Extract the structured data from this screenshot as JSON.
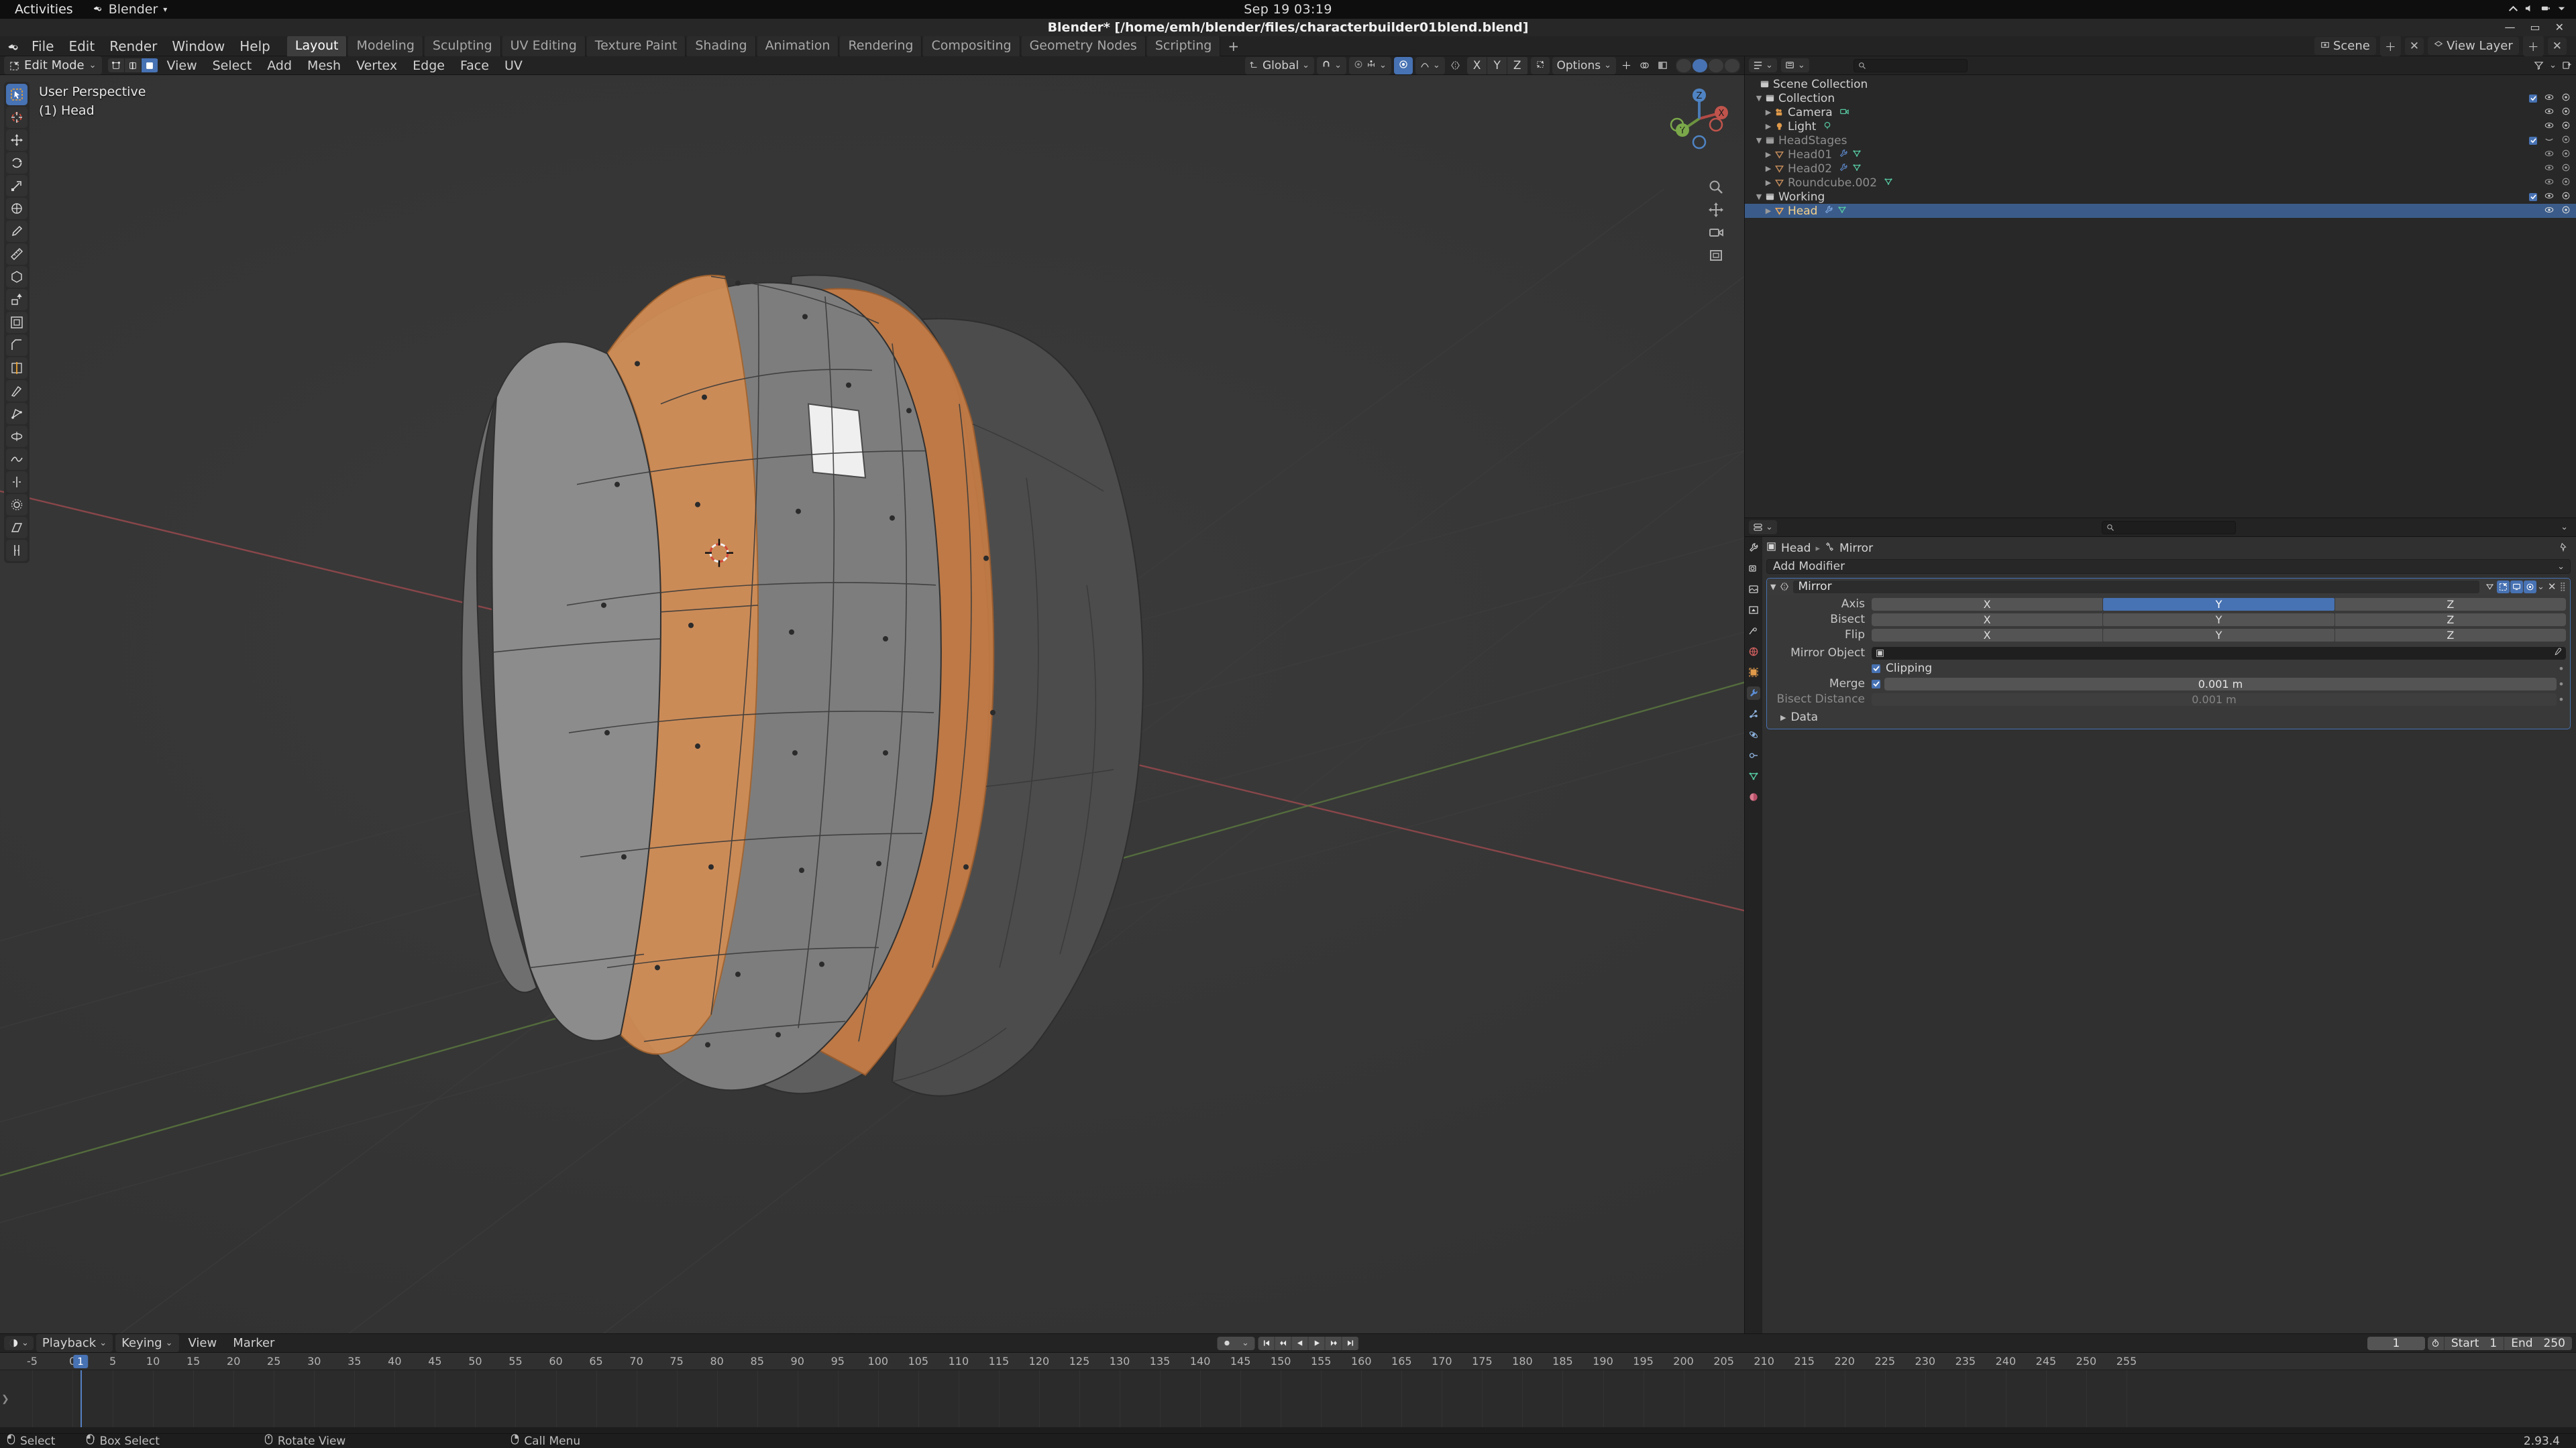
{
  "gnome": {
    "activities": "Activities",
    "app_name": "Blender",
    "app_menu_caret": "▾",
    "clock": "Sep 19  03:19"
  },
  "window": {
    "title": "Blender* [/home/emh/blender/files/characterbuilder01blend.blend]",
    "minimize": "—",
    "maximize": "▭",
    "close": "✕"
  },
  "topbar": {
    "menus": [
      "File",
      "Edit",
      "Render",
      "Window",
      "Help"
    ],
    "workspaces": [
      {
        "label": "Layout",
        "active": true
      },
      {
        "label": "Modeling",
        "active": false
      },
      {
        "label": "Sculpting",
        "active": false
      },
      {
        "label": "UV Editing",
        "active": false
      },
      {
        "label": "Texture Paint",
        "active": false
      },
      {
        "label": "Shading",
        "active": false
      },
      {
        "label": "Animation",
        "active": false
      },
      {
        "label": "Rendering",
        "active": false
      },
      {
        "label": "Compositing",
        "active": false
      },
      {
        "label": "Geometry Nodes",
        "active": false
      },
      {
        "label": "Scripting",
        "active": false
      }
    ],
    "add_workspace": "+",
    "scene_name": "Scene",
    "view_layer_name": "View Layer"
  },
  "viewport": {
    "mode": "Edit Mode",
    "mode_caret": "⌄",
    "select_modes": [
      "vertex-select",
      "edge-select",
      "face-select"
    ],
    "active_select_mode": "face-select",
    "menus": [
      "View",
      "Select",
      "Add",
      "Mesh",
      "Vertex",
      "Edge",
      "Face",
      "UV"
    ],
    "transform_orientation": "Global",
    "snap_caret": "⌄",
    "proportional_axes": [
      "X",
      "Y",
      "Z"
    ],
    "options_label": "Options",
    "options_caret": "⌄",
    "overlay_line1": "User Perspective",
    "overlay_line2": "(1) Head",
    "gizmo_axes": [
      "X",
      "Y",
      "Z"
    ],
    "tools": [
      "tweak-select-tool",
      "cursor-tool",
      "move-tool",
      "rotate-tool",
      "scale-tool",
      "transform-tool",
      "annotate-tool",
      "measure-tool",
      "add-cube-tool",
      "extrude-region-tool",
      "inset-faces-tool",
      "bevel-tool",
      "loop-cut-tool",
      "knife-tool",
      "poly-build-tool",
      "spin-tool",
      "smooth-tool",
      "edge-slide-tool",
      "shrink-fatten-tool",
      "shear-tool",
      "rip-region-tool"
    ]
  },
  "outliner": {
    "display_mode": "view-layer",
    "search_placeholder": "",
    "filter_icon": "filter-icon",
    "new_collection_icon": "new-collection-icon",
    "rows": [
      {
        "label": "Scene Collection",
        "icon": "collection-icon",
        "indent": 0,
        "disclosure": "",
        "selected": false,
        "dim": false,
        "checkbox": false,
        "eye": false,
        "camera": false,
        "extras": []
      },
      {
        "label": "Collection",
        "icon": "collection-icon",
        "indent": 1,
        "disclosure": "▼",
        "selected": false,
        "dim": false,
        "checkbox": true,
        "eye": true,
        "camera": true,
        "extras": []
      },
      {
        "label": "Camera",
        "icon": "camera-obj-icon",
        "indent": 2,
        "disclosure": "▶",
        "selected": false,
        "dim": false,
        "checkbox": false,
        "eye": true,
        "camera": true,
        "extras": [
          "camera-data-icon"
        ]
      },
      {
        "label": "Light",
        "icon": "light-obj-icon",
        "indent": 2,
        "disclosure": "▶",
        "selected": false,
        "dim": false,
        "checkbox": false,
        "eye": true,
        "camera": true,
        "extras": [
          "light-data-icon"
        ]
      },
      {
        "label": "HeadStages",
        "icon": "collection-icon",
        "indent": 1,
        "disclosure": "▼",
        "selected": false,
        "dim": true,
        "checkbox": true,
        "eye": false,
        "camera": true,
        "extras": []
      },
      {
        "label": "Head01",
        "icon": "mesh-obj-icon",
        "indent": 2,
        "disclosure": "▶",
        "selected": false,
        "dim": true,
        "checkbox": false,
        "eye": true,
        "camera": true,
        "extras": [
          "modifier-icon",
          "mesh-data-icon"
        ]
      },
      {
        "label": "Head02",
        "icon": "mesh-obj-icon",
        "indent": 2,
        "disclosure": "▶",
        "selected": false,
        "dim": true,
        "checkbox": false,
        "eye": true,
        "camera": true,
        "extras": [
          "modifier-icon",
          "mesh-data-icon"
        ]
      },
      {
        "label": "Roundcube.002",
        "icon": "mesh-obj-icon",
        "indent": 2,
        "disclosure": "▶",
        "selected": false,
        "dim": true,
        "checkbox": false,
        "eye": true,
        "camera": true,
        "extras": [
          "mesh-data-icon"
        ]
      },
      {
        "label": "Working",
        "icon": "collection-icon",
        "indent": 1,
        "disclosure": "▼",
        "selected": false,
        "dim": false,
        "checkbox": true,
        "eye": true,
        "camera": true,
        "extras": []
      },
      {
        "label": "Head",
        "icon": "mesh-obj-icon",
        "indent": 2,
        "disclosure": "▶",
        "selected": true,
        "dim": false,
        "checkbox": false,
        "eye": true,
        "camera": true,
        "extras": [
          "modifier-icon",
          "mesh-data-icon"
        ]
      }
    ]
  },
  "properties": {
    "search_placeholder": "",
    "breadcrumb_object": "Head",
    "breadcrumb_modifier": "Mirror",
    "tabs": [
      "tool-tab",
      "render-tab",
      "output-tab",
      "view-layer-tab",
      "scene-tab",
      "world-tab",
      "object-tab",
      "modifier-tab",
      "particles-tab",
      "physics-tab",
      "constraints-tab",
      "object-data-tab",
      "material-tab"
    ],
    "active_tab": "modifier-tab",
    "add_modifier_label": "Add Modifier",
    "modifier": {
      "name": "Mirror",
      "header_toggles": [
        "on-cage",
        "edit-mode-display",
        "realtime-display",
        "render-display"
      ],
      "axis_label": "Axis",
      "axis_options": [
        "X",
        "Y",
        "Z"
      ],
      "axis_active": "Y",
      "bisect_label": "Bisect",
      "bisect_options": [
        "X",
        "Y",
        "Z"
      ],
      "bisect_active": "",
      "flip_label": "Flip",
      "flip_options": [
        "X",
        "Y",
        "Z"
      ],
      "flip_active": "",
      "mirror_object_label": "Mirror Object",
      "mirror_object_value": "",
      "clipping_label": "Clipping",
      "clipping_checked": true,
      "merge_label": "Merge",
      "merge_checked": true,
      "merge_value": "0.001 m",
      "bisect_distance_label": "Bisect Distance",
      "bisect_distance_value": "0.001 m",
      "data_label": "Data"
    }
  },
  "timeline": {
    "editor_icon": "timeline-editor-icon",
    "menus": [
      "Playback",
      "Keying",
      "View",
      "Marker"
    ],
    "playback_caret": "⌄",
    "keying_caret": "⌄",
    "transport": [
      "jump-start",
      "prev-keyframe",
      "play-reverse",
      "play",
      "next-keyframe",
      "jump-end"
    ],
    "record_caret": "⌄",
    "current_frame": "1",
    "start_label": "Start",
    "start_value": "1",
    "end_label": "End",
    "end_value": "250",
    "playhead_badge": "1",
    "ruler_ticks": [
      "-5",
      "0",
      "5",
      "10",
      "15",
      "20",
      "25",
      "30",
      "35",
      "40",
      "45",
      "50",
      "55",
      "60",
      "65",
      "70",
      "75",
      "80",
      "85",
      "90",
      "95",
      "100",
      "105",
      "110",
      "115",
      "120",
      "125",
      "130",
      "135",
      "140",
      "145",
      "150",
      "155",
      "160",
      "165",
      "170",
      "175",
      "180",
      "185",
      "190",
      "195",
      "200",
      "205",
      "210",
      "215",
      "220",
      "225",
      "230",
      "235",
      "240",
      "245",
      "250",
      "255"
    ]
  },
  "statusbar": {
    "hints": [
      {
        "icon": "mouse-left-icon",
        "label": "Select"
      },
      {
        "icon": "mouse-left-drag-icon",
        "label": "Box Select"
      },
      {
        "icon": "mouse-middle-icon",
        "label": "Rotate View"
      },
      {
        "icon": "mouse-right-icon",
        "label": "Call Menu"
      }
    ],
    "version": "2.93.4"
  },
  "colors": {
    "accent_blue": "#4772b3",
    "selected_orange": "#e08a4a",
    "mesh_gray": "#8a8a8a",
    "bg_dark": "#1d1d1d"
  }
}
